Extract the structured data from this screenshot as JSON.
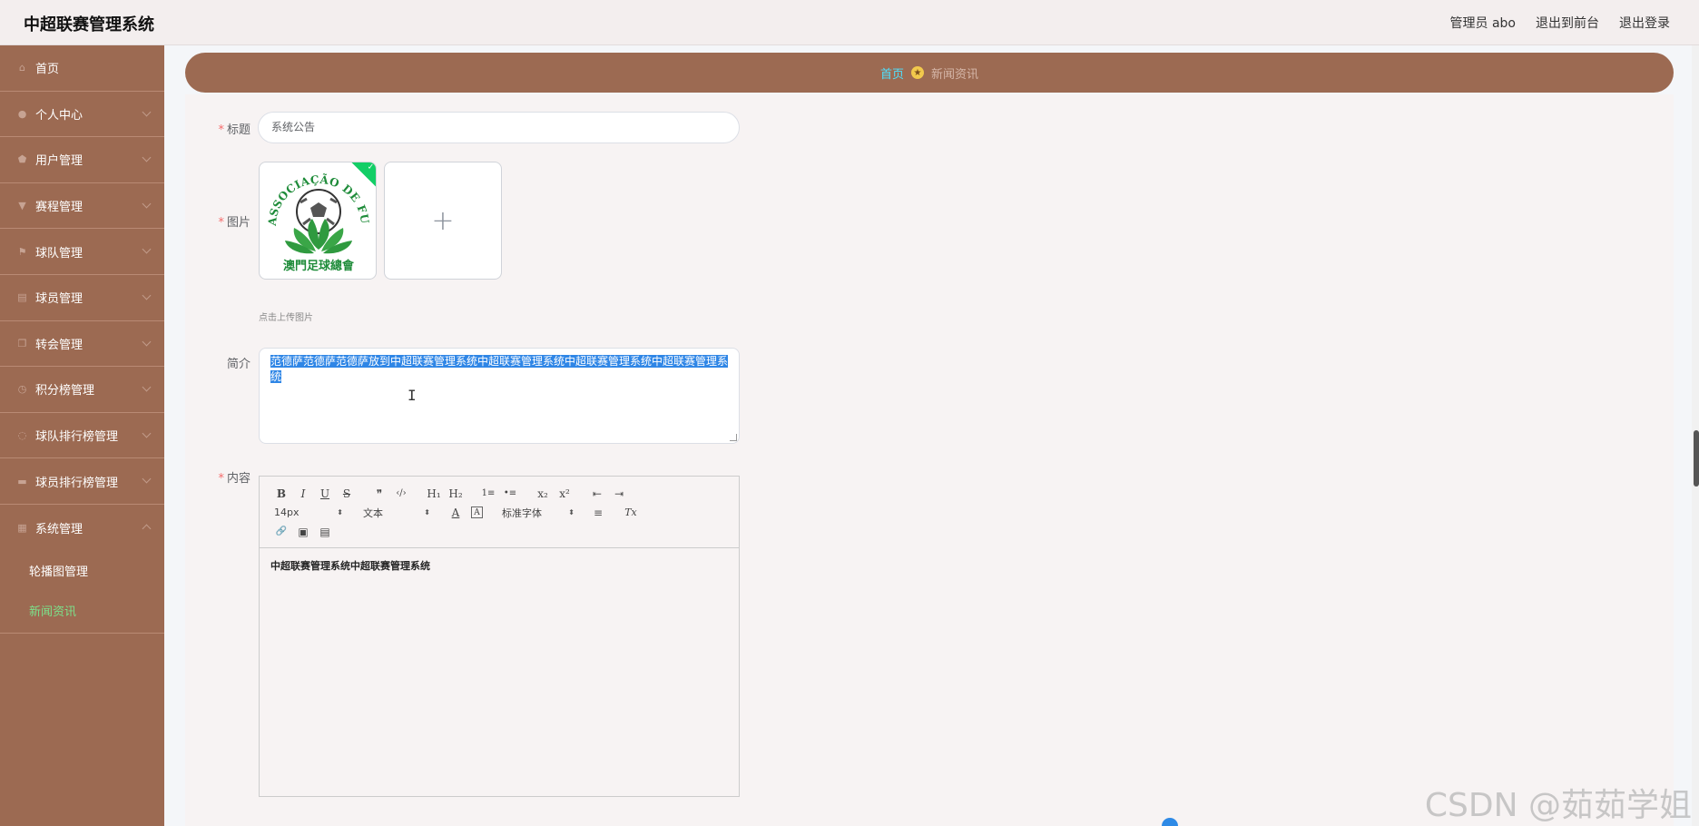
{
  "app": {
    "title": "中超联赛管理系统"
  },
  "header": {
    "user_label": "管理员 abo",
    "front_link": "退出到前台",
    "logout_link": "退出登录"
  },
  "sidebar": {
    "items": [
      {
        "label": "首页",
        "icon": "home-icon"
      },
      {
        "label": "个人中心",
        "icon": "user-icon"
      },
      {
        "label": "用户管理",
        "icon": "shield-icon"
      },
      {
        "label": "赛程管理",
        "icon": "chat-icon"
      },
      {
        "label": "球队管理",
        "icon": "flag-icon"
      },
      {
        "label": "球员管理",
        "icon": "clipboard-icon"
      },
      {
        "label": "转会管理",
        "icon": "copy-icon"
      },
      {
        "label": "积分榜管理",
        "icon": "clock-icon"
      },
      {
        "label": "球队排行榜管理",
        "icon": "loading-icon"
      },
      {
        "label": "球员排行榜管理",
        "icon": "comment-icon"
      },
      {
        "label": "系统管理",
        "icon": "grid-icon"
      }
    ],
    "sub_items": [
      {
        "label": "轮播图管理"
      },
      {
        "label": "新闻资讯"
      }
    ],
    "active_color": "#7ce08a",
    "bg_color": "#9c6a52"
  },
  "breadcrumb": {
    "home": "首页",
    "current": "新闻资讯"
  },
  "form": {
    "title_label": "标题",
    "title_value": "系统公告",
    "image_label": "图片",
    "upload_tip": "点击上传图片",
    "upload_plus": "+",
    "intro_label": "简介",
    "intro_value": "范德萨范德萨范德萨放到中超联赛管理系统中超联赛管理系统中超联赛管理系统中超联赛管理系统",
    "content_label": "内容",
    "content_value": "中超联赛管理系统中超联赛管理系统",
    "required_mark": "*"
  },
  "image": {
    "logo_text_top": "ASSOCIAÇÃO DE FUTEBOL DE MACAU",
    "logo_text_bottom": "澳門足球總會"
  },
  "editor": {
    "font_size": "14px",
    "text_style": "文本",
    "font_family": "标准字体",
    "buttons": {
      "bold": "B",
      "italic": "I",
      "underline": "U",
      "strike": "S",
      "quote": "❞",
      "code": "‹/›",
      "h1": "H₁",
      "h2": "H₂",
      "ol": "1≡",
      "ul": "•≡",
      "sub": "x₂",
      "sup": "x²",
      "outdent": "⇤",
      "indent": "⇥",
      "color": "A",
      "background": "A",
      "align": "≡",
      "clean": "Tx",
      "link": "🔗",
      "image": "▣",
      "video": "▤"
    }
  },
  "watermark": "CSDN @茹茹学姐"
}
